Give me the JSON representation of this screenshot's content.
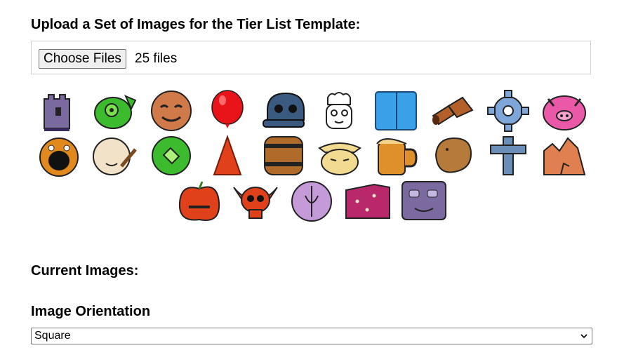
{
  "upload": {
    "heading": "Upload a Set of Images for the Tier List Template:",
    "choose_files_label": "Choose Files",
    "file_count_text": "25 files"
  },
  "images": {
    "rows": [
      [
        {
          "name": "castle-tower",
          "color": "#7a6aa0"
        },
        {
          "name": "green-bean-face",
          "color": "#3dbb2f"
        },
        {
          "name": "cookie-face",
          "color": "#d07a4a"
        },
        {
          "name": "red-balloon",
          "color": "#e8141a"
        },
        {
          "name": "blue-skull",
          "color": "#3b5a80"
        },
        {
          "name": "chef-head",
          "color": "#ffffff"
        },
        {
          "name": "blue-block",
          "color": "#3aa0e8"
        },
        {
          "name": "brown-pipe",
          "color": "#b4602a"
        },
        {
          "name": "blue-gear",
          "color": "#7ea6d8"
        },
        {
          "name": "pink-pig",
          "color": "#ea58a8"
        }
      ],
      [
        {
          "name": "orange-screaming-face",
          "color": "#e2891e"
        },
        {
          "name": "cream-pot",
          "color": "#f2e2c8"
        },
        {
          "name": "green-gem-circle",
          "color": "#3dbb2f"
        },
        {
          "name": "red-cone",
          "color": "#e0401a"
        },
        {
          "name": "wooden-barrel",
          "color": "#b06a2a"
        },
        {
          "name": "cowboy-hat-face",
          "color": "#f2da90"
        },
        {
          "name": "beer-mug",
          "color": "#e0902a"
        },
        {
          "name": "brown-potato",
          "color": "#b67a3a"
        },
        {
          "name": "blue-cross",
          "color": "#6a8eb8"
        },
        {
          "name": "orange-rocks",
          "color": "#e08050"
        }
      ],
      [
        {
          "name": "red-apple-face",
          "color": "#e0401a"
        },
        {
          "name": "red-horned-skull",
          "color": "#e0401a"
        },
        {
          "name": "purple-shield",
          "color": "#c49ad8"
        },
        {
          "name": "magenta-cheese-block",
          "color": "#b8286a"
        },
        {
          "name": "purple-square-face",
          "color": "#7a6aa0"
        }
      ]
    ]
  },
  "current": {
    "heading": "Current Images:"
  },
  "orientation": {
    "heading": "Image Orientation",
    "selected": "Square"
  }
}
